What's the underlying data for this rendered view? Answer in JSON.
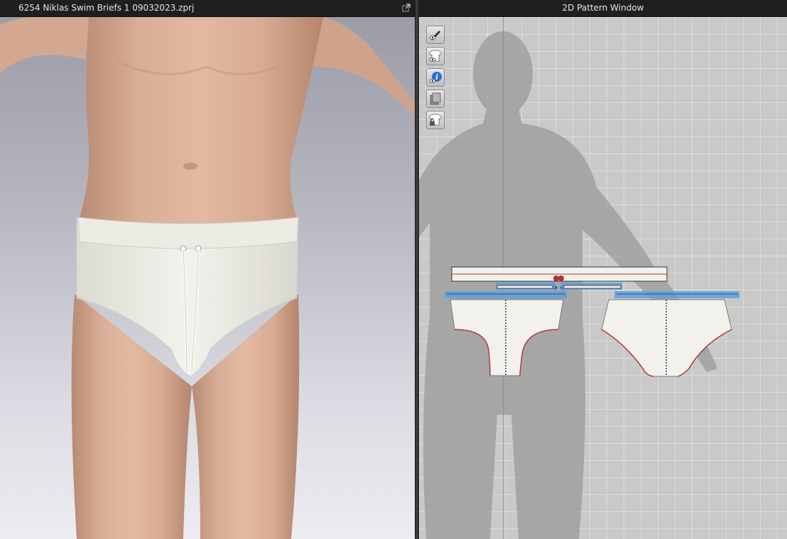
{
  "window_3d": {
    "title": "6254 Niklas Swim Briefs 1 09032023.zprj"
  },
  "window_2d": {
    "title": "2D Pattern Window"
  },
  "toolbar_2d": [
    {
      "icon": "pen-eye-icon"
    },
    {
      "icon": "shirt-eye-icon"
    },
    {
      "icon": "info-eye-icon"
    },
    {
      "icon": "layers-icon"
    },
    {
      "icon": "shirt-lock-icon"
    }
  ],
  "colors": {
    "titlebar": "#1f1f1f",
    "pattern_fill": "#f2f1ec",
    "binding_blue": "#5aa0e0",
    "seam_red": "#b03a3a",
    "avatar_silhouette": "#8f8f8f"
  }
}
